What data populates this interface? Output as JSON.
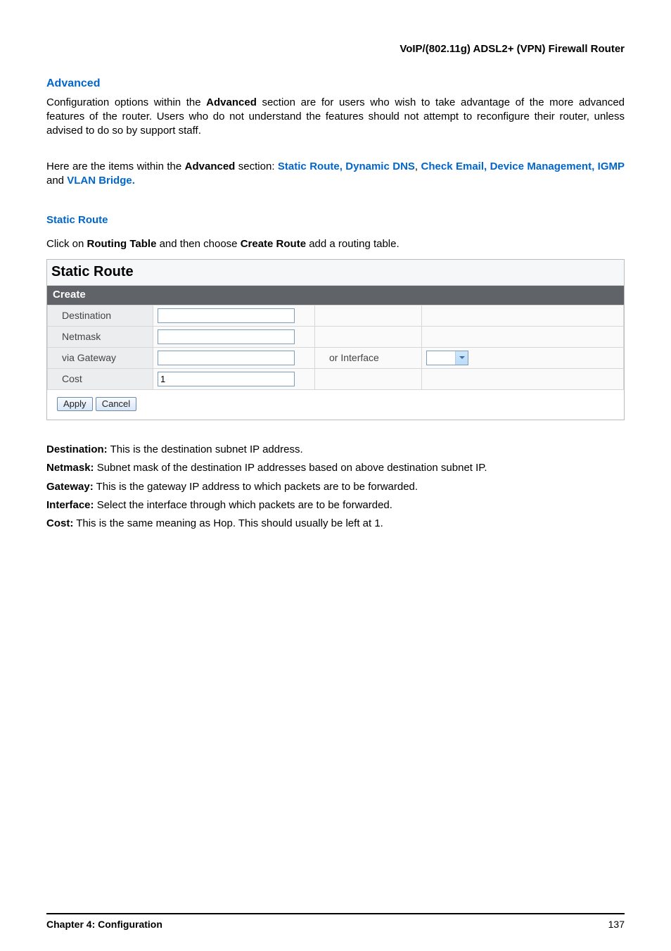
{
  "doc": {
    "header": "VoIP/(802.11g) ADSL2+ (VPN) Firewall Router",
    "h_advanced": "Advanced",
    "p1_a": "Configuration options within the ",
    "p1_b": "Advanced",
    "p1_c": " section are for users who wish to take advantage of the more advanced features of the router. Users who do not understand the features should not attempt to reconfigure their router, unless advised to do so by support staff.",
    "p2_a": "Here are the items within the ",
    "p2_b": "Advanced",
    "p2_c": " section: ",
    "links1": "Static Route, Dynamic DNS",
    "sep1": ", ",
    "links2": "Check Email, Device Management, IGMP",
    "sep2": " and ",
    "links3": "VLAN Bridge.",
    "h_static": "Static Route",
    "inst_a": "Click on ",
    "inst_b": "Routing Table",
    "inst_c": " and then choose ",
    "inst_d": "Create Route",
    "inst_e": " add a routing table.",
    "footer_chapter": "Chapter 4: Configuration",
    "footer_page": "137"
  },
  "panel": {
    "title": "Static Route",
    "subhead": "Create",
    "rows": {
      "destination": {
        "label": "Destination",
        "value": ""
      },
      "netmask": {
        "label": "Netmask",
        "value": ""
      },
      "gateway": {
        "label": "via Gateway",
        "value": "",
        "alt_label": "or Interface",
        "selected": ""
      },
      "cost": {
        "label": "Cost",
        "value": "1"
      }
    },
    "buttons": {
      "apply": "Apply",
      "cancel": "Cancel"
    }
  },
  "descriptions": {
    "dest_l": "Destination:",
    "dest_t": " This is the destination subnet IP address.",
    "net_l": "Netmask:",
    "net_t": " Subnet mask of the destination IP addresses based on above destination subnet IP.",
    "gw_l": "Gateway:",
    "gw_t": " This is the gateway IP address to which packets are to be forwarded.",
    "if_l": "Interface:",
    "if_t": " Select the interface through which packets are to be forwarded.",
    "cost_l": "Cost:",
    "cost_t": " This is the same meaning as Hop. This should usually be left at 1."
  }
}
